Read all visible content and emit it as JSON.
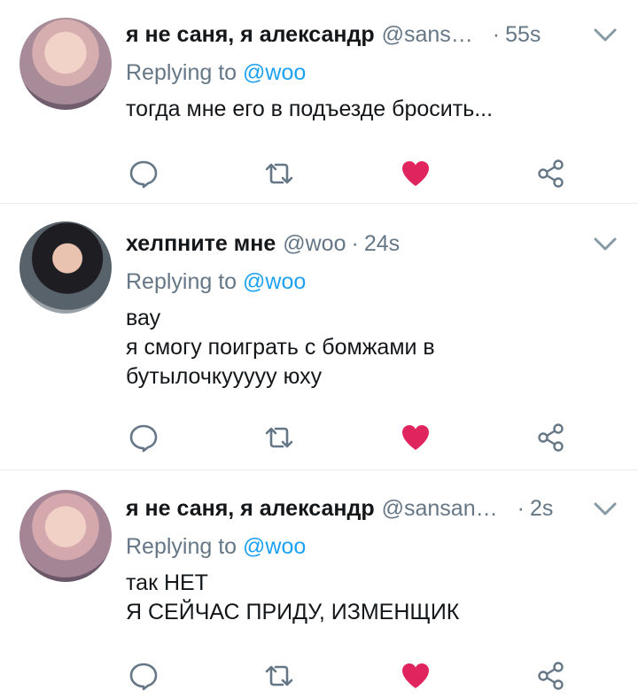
{
  "tweets": [
    {
      "name": "я не саня, я александр",
      "handle": "@sans…",
      "time": "55s",
      "replying_prefix": "Replying to",
      "replying_to": "@woo",
      "text": "тогда мне его в подъезде бросить..."
    },
    {
      "name": "хелпните мне",
      "handle": "@woo",
      "time": "24s",
      "replying_prefix": "Replying to",
      "replying_to": "@woo",
      "text": "вау\nя смогу поиграть с бомжами в\nбутылочкууууу юху"
    },
    {
      "name": "я не саня, я александр",
      "handle": "@sansan…",
      "time": "2s",
      "replying_prefix": "Replying to",
      "replying_to": "@woo",
      "text": "так НЕТ\nЯ СЕЙЧАС ПРИДУ, ИЗМЕНЩИК"
    }
  ],
  "icons": {
    "reply": "speech-bubble-icon",
    "retweet": "retweet-icon",
    "like": "heart-icon",
    "share": "share-icon",
    "menu": "chevron-down-icon"
  },
  "colors": {
    "like": "#e0245e",
    "icon": "#657786",
    "mention": "#1da1f2",
    "divider": "#e6ecf0"
  }
}
